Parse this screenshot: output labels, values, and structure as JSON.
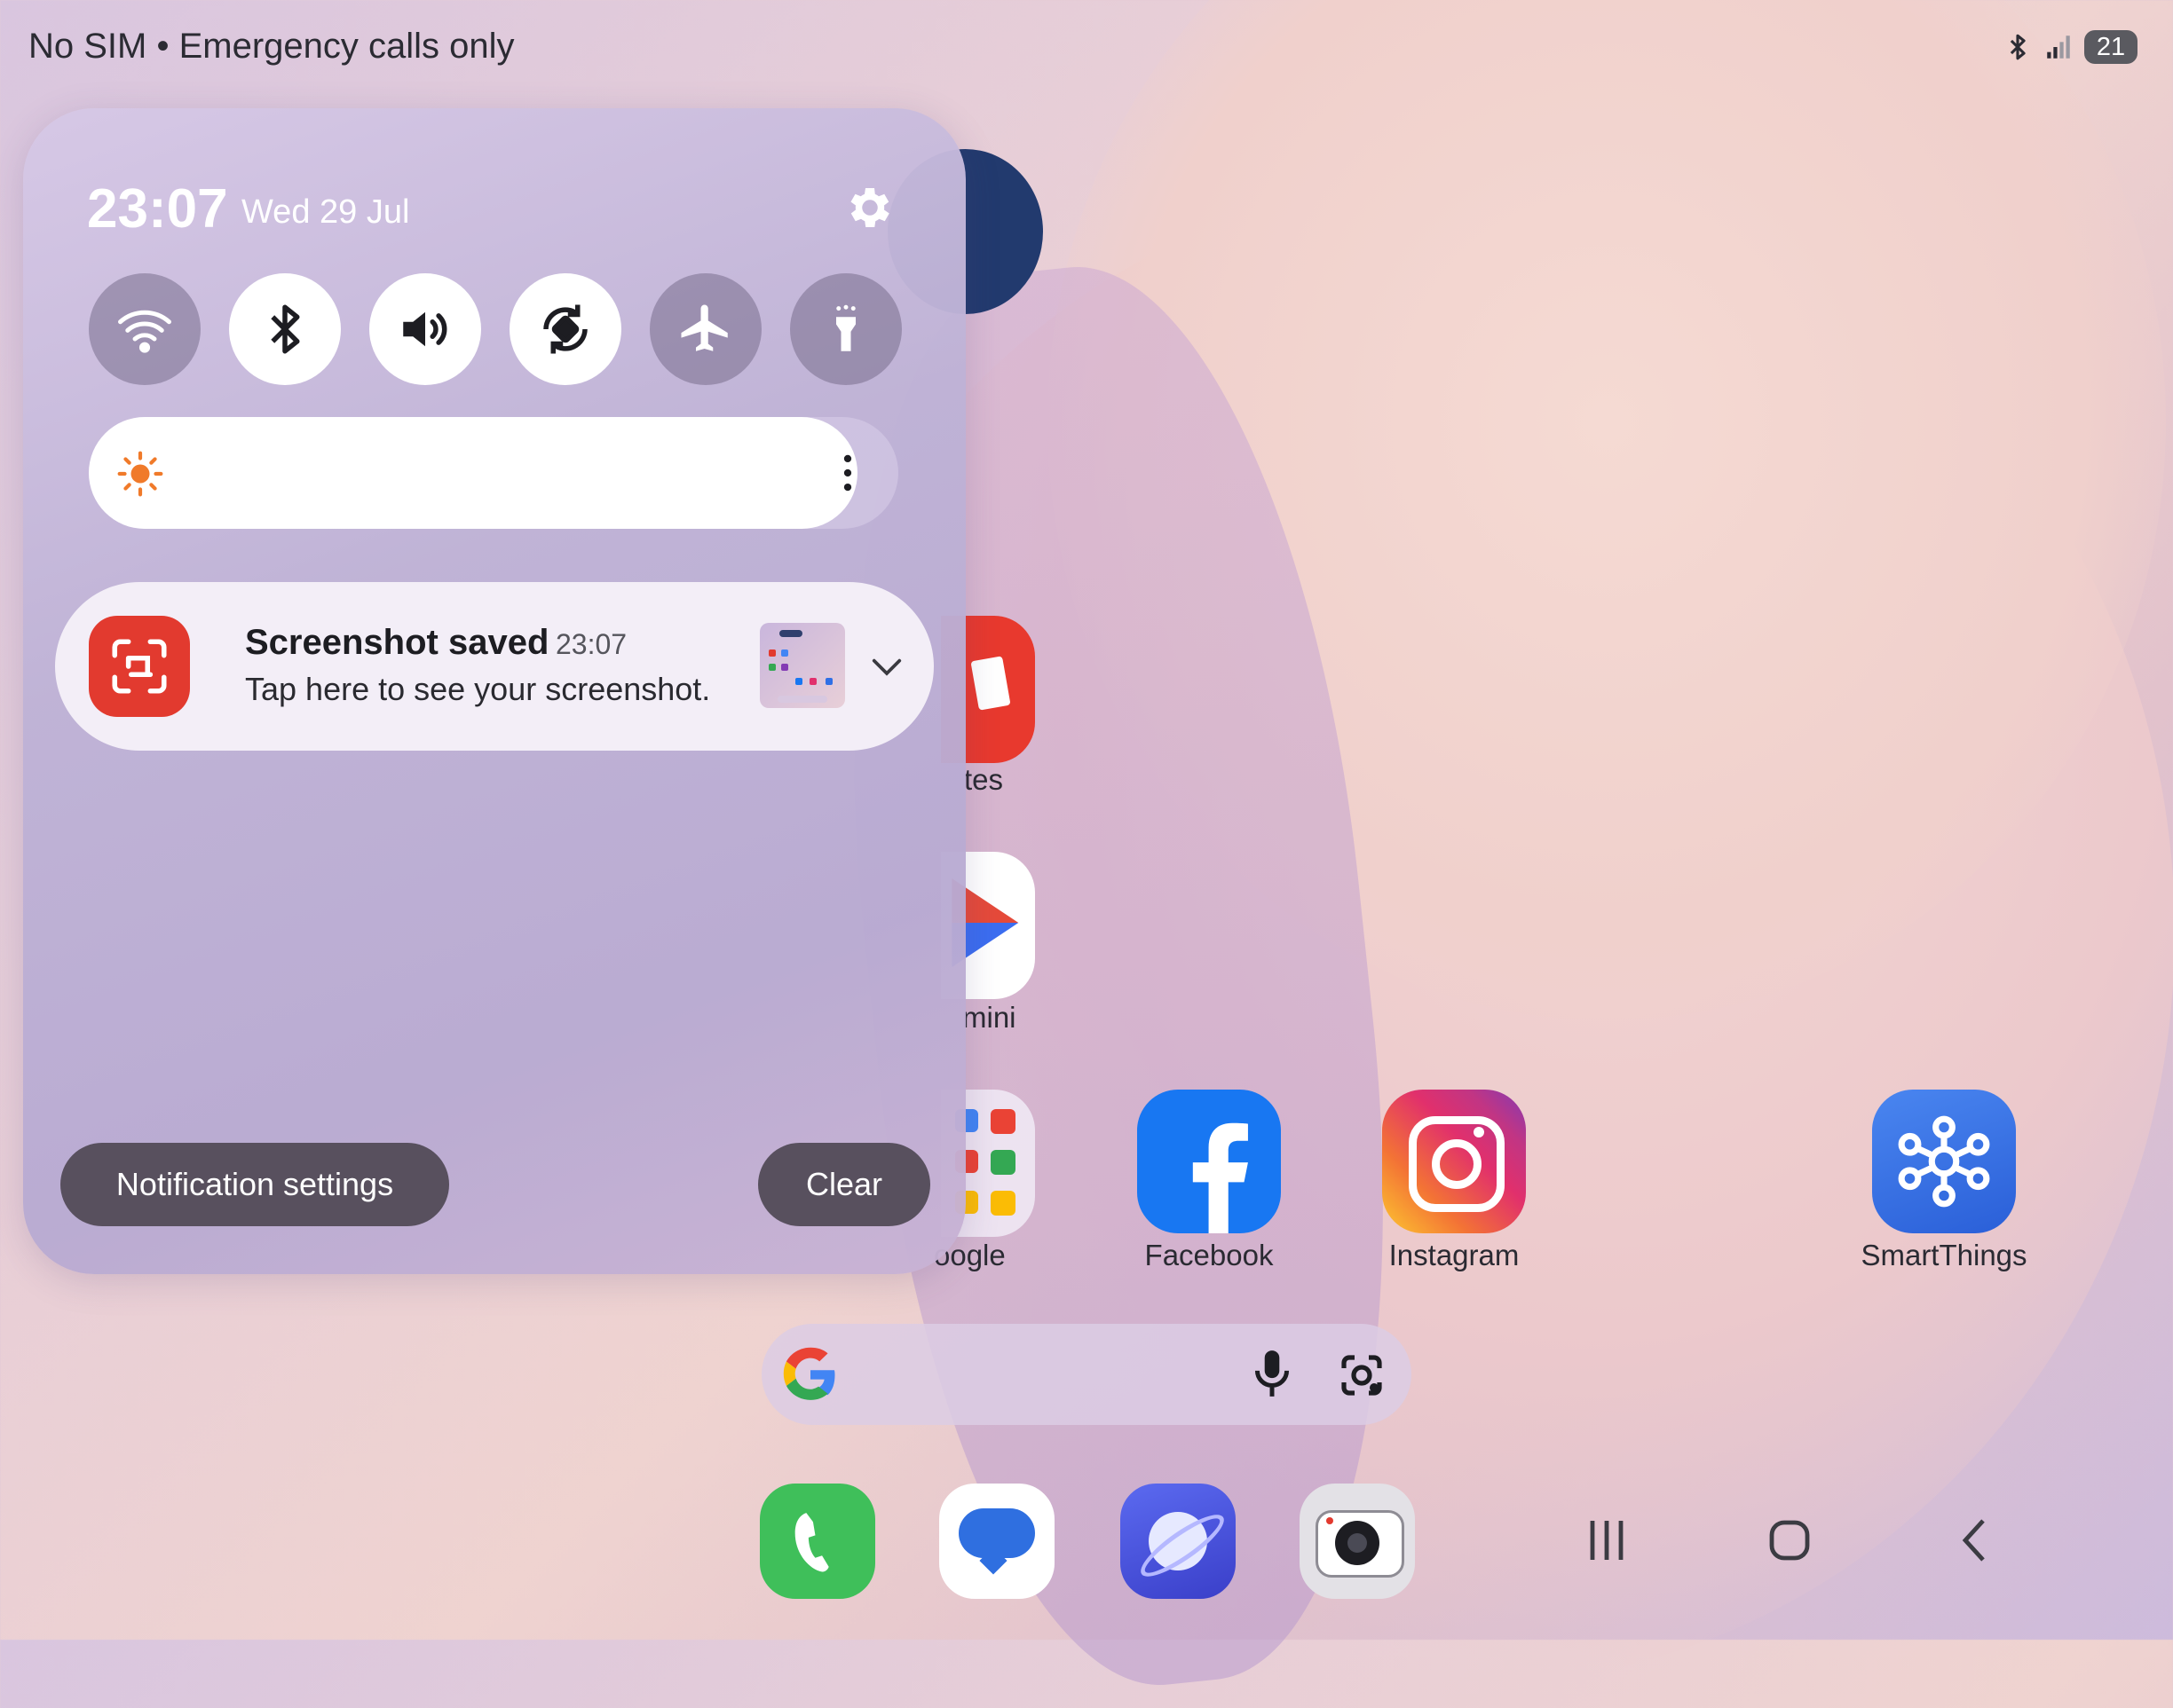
{
  "status_bar": {
    "carrier": "No SIM • Emergency calls only",
    "battery": "21"
  },
  "panel": {
    "time": "23:07",
    "date": "Wed 29 Jul"
  },
  "toggles": [
    {
      "name": "wifi-icon",
      "state": "off"
    },
    {
      "name": "bluetooth-icon",
      "state": "on"
    },
    {
      "name": "sound-icon",
      "state": "on"
    },
    {
      "name": "auto-rotate-icon",
      "state": "on"
    },
    {
      "name": "airplane-icon",
      "state": "off"
    },
    {
      "name": "flashlight-icon",
      "state": "off"
    }
  ],
  "brightness": {
    "level": 0.95
  },
  "notification": {
    "title": "Screenshot saved",
    "time": "23:07",
    "text": "Tap here to see your screenshot."
  },
  "buttons": {
    "notification_settings": "Notification settings",
    "clear": "Clear"
  },
  "home": {
    "partial_labels": [
      "tes",
      "mini",
      "oogle"
    ],
    "apps": [
      "Facebook",
      "Instagram",
      "SmartThings"
    ]
  },
  "colors": {
    "accent_red": "#e23a2f",
    "facebook_blue": "#1877f2",
    "smartthings_blue": "#2f6fe6"
  }
}
